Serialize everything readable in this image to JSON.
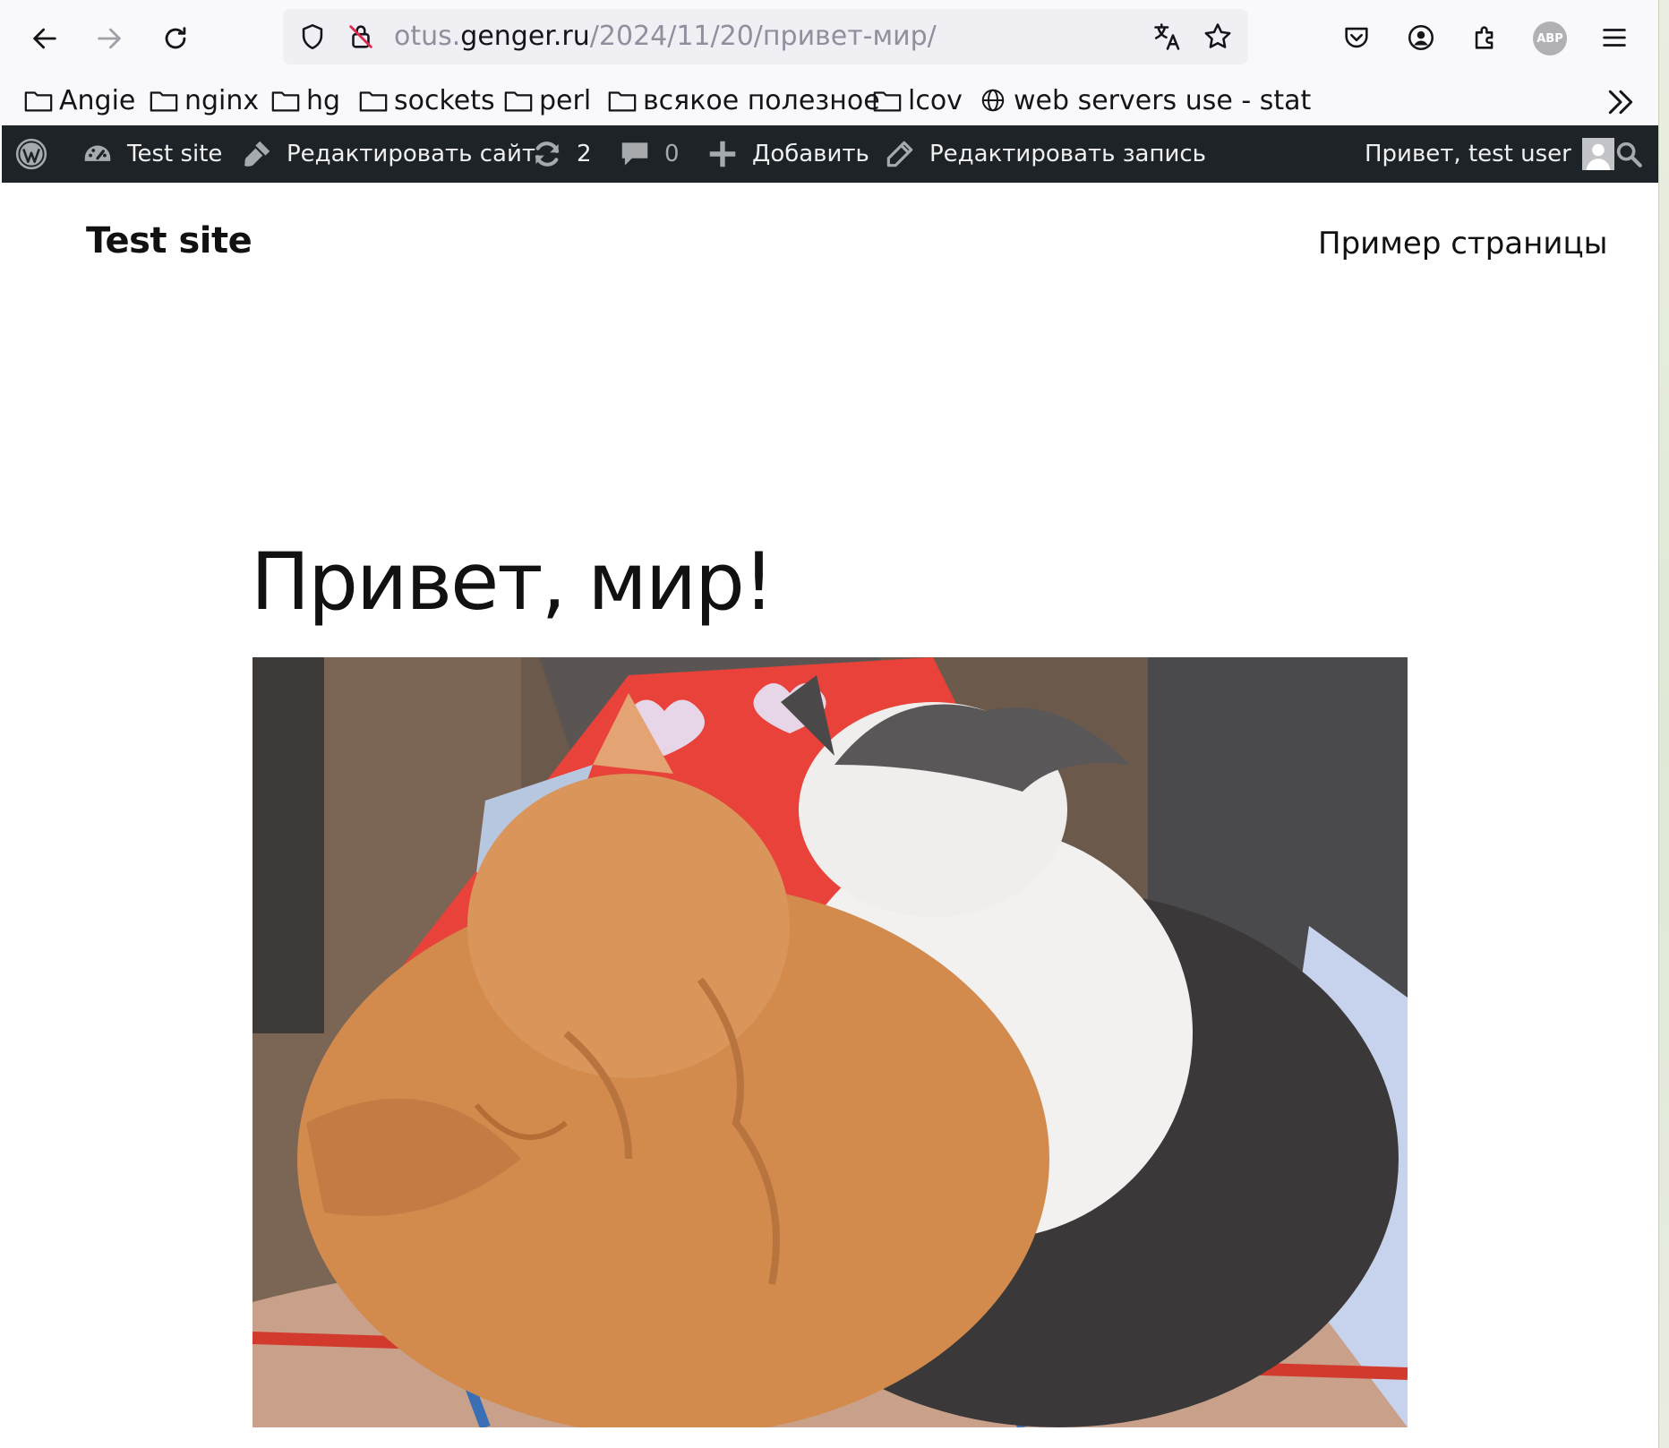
{
  "browser": {
    "url_prefix": "otus.",
    "url_host": "genger.ru",
    "url_path": "/2024/11/20/привет-мир/",
    "abp_label": "ABP"
  },
  "bookmarks": [
    {
      "label": "Angie",
      "icon": "folder-icon"
    },
    {
      "label": "nginx",
      "icon": "folder-icon"
    },
    {
      "label": "hg",
      "icon": "folder-icon"
    },
    {
      "label": "sockets",
      "icon": "folder-icon"
    },
    {
      "label": "perl",
      "icon": "folder-icon"
    },
    {
      "label": "всякое полезное",
      "icon": "folder-icon"
    },
    {
      "label": "lcov",
      "icon": "folder-icon"
    },
    {
      "label": "web servers use - stat",
      "icon": "globe-icon"
    }
  ],
  "adminbar": {
    "site_name": "Test site",
    "customize": "Редактировать сайт",
    "updates_count": "2",
    "comments_count": "0",
    "new_content": "Добавить",
    "edit_post": "Редактировать запись",
    "greeting": "Привет, test user"
  },
  "site": {
    "title": "Test site",
    "nav_link": "Пример страницы"
  },
  "post": {
    "title": "Привет, мир!",
    "image_description": "photo-two-sleeping-cats"
  },
  "colors": {
    "adminbar_bg": "#1d2327",
    "adminbar_text": "#f0f0f1",
    "chrome_bg": "#f9f9fb",
    "urlbar_bg": "#f0f0f4"
  }
}
